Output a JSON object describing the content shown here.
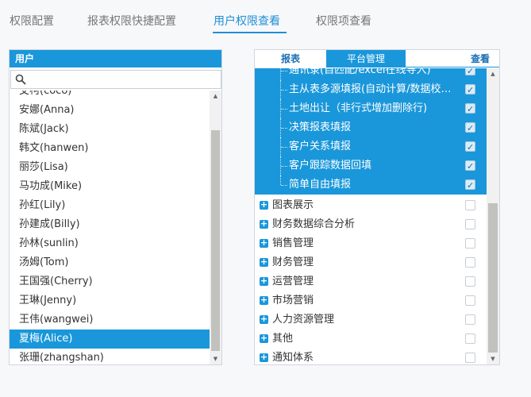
{
  "tabs": [
    {
      "label": "权限配置"
    },
    {
      "label": "报表权限快捷配置"
    },
    {
      "label": "用户权限查看"
    },
    {
      "label": "权限项查看"
    }
  ],
  "user_panel": {
    "header": "用户",
    "search_placeholder": "",
    "users": [
      {
        "label": "艾柯(coco)"
      },
      {
        "label": "安娜(Anna)"
      },
      {
        "label": "陈斌(Jack)"
      },
      {
        "label": "韩文(hanwen)"
      },
      {
        "label": "丽莎(Lisa)"
      },
      {
        "label": "马功成(Mike)"
      },
      {
        "label": "孙红(Lily)"
      },
      {
        "label": "孙建成(Billy)"
      },
      {
        "label": "孙林(sunlin)"
      },
      {
        "label": "汤姆(Tom)"
      },
      {
        "label": "王国强(Cherry)"
      },
      {
        "label": "王琳(Jenny)"
      },
      {
        "label": "王伟(wangwei)"
      },
      {
        "label": "夏梅(Alice)"
      },
      {
        "label": "张珊(zhangshan)"
      }
    ],
    "selected_user": "夏梅(Alice)"
  },
  "perm_panel": {
    "tab_report": "报表",
    "tab_platform": "平台管理",
    "view_link": "查看",
    "sub_items": [
      {
        "label": "通讯录(自匹配/excel在线导入)",
        "checked": true
      },
      {
        "label": "主从表多源填报(自动计算/数据校…",
        "checked": true
      },
      {
        "label": "土地出让（非行式增加删除行)",
        "checked": true
      },
      {
        "label": "决策报表填报",
        "checked": true
      },
      {
        "label": "客户关系填报",
        "checked": true
      },
      {
        "label": "客户跟踪数据回填",
        "checked": true
      },
      {
        "label": "简单自由填报",
        "checked": true
      }
    ],
    "groups": [
      {
        "label": "图表展示",
        "checked": false
      },
      {
        "label": "财务数据综合分析",
        "checked": false
      },
      {
        "label": "销售管理",
        "checked": false
      },
      {
        "label": "财务管理",
        "checked": false
      },
      {
        "label": "运营管理",
        "checked": false
      },
      {
        "label": "市场营销",
        "checked": false
      },
      {
        "label": "人力资源管理",
        "checked": false
      },
      {
        "label": "其他",
        "checked": false
      },
      {
        "label": "通知体系",
        "checked": false
      }
    ]
  },
  "colors": {
    "accent": "#1a97da",
    "tab_active": "#1f8fd6"
  }
}
